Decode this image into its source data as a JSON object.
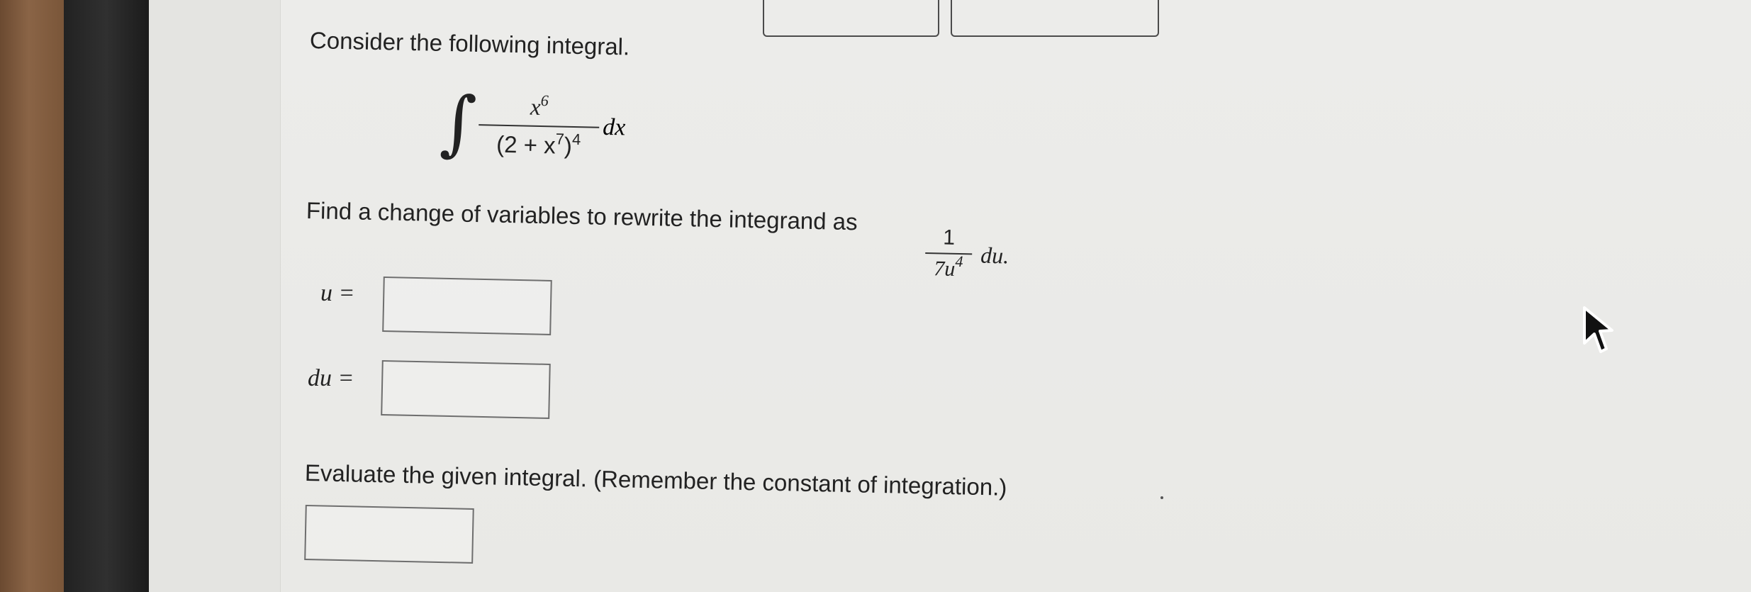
{
  "page": {
    "intro": "Consider the following integral.",
    "integral": {
      "numerator": "x6",
      "numerator_base": "x",
      "numerator_exp": "6",
      "denominator_prefix": "(2 + x",
      "denominator_inner_exp": "7",
      "denominator_suffix": ")",
      "denominator_outer_exp": "4",
      "differential": "dx"
    },
    "find_instruction": "Find a change of variables to rewrite the integrand as",
    "rewrite": {
      "numerator": "1",
      "denominator_prefix": "7u",
      "denominator_exp": "4",
      "differential": "du."
    },
    "u_label": "u =",
    "du_label": "du =",
    "evaluate_instruction": "Evaluate the given integral. (Remember the constant of integration.)"
  }
}
